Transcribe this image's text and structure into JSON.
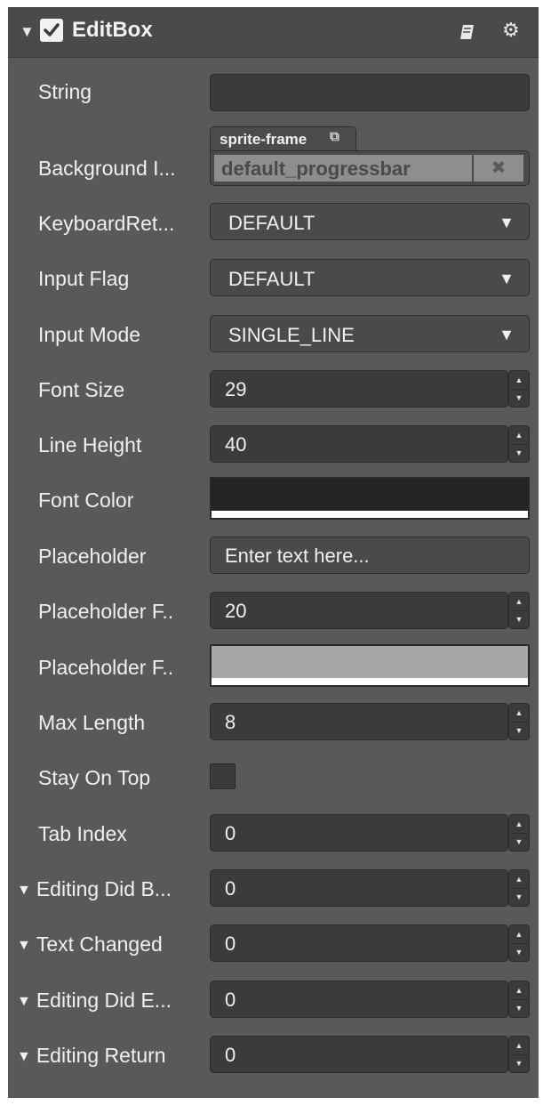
{
  "header": {
    "title": "EditBox",
    "enabled": true,
    "icons": [
      "book-icon",
      "gear-icon"
    ]
  },
  "fields": {
    "string": {
      "label": "String",
      "value": ""
    },
    "background": {
      "label": "Background I...",
      "tag": "sprite-frame",
      "value": "default_progressbar",
      "clear": "✖"
    },
    "keyboard_return": {
      "label": "KeyboardRet...",
      "value": "DEFAULT"
    },
    "input_flag": {
      "label": "Input Flag",
      "value": "DEFAULT"
    },
    "input_mode": {
      "label": "Input Mode",
      "value": "SINGLE_LINE"
    },
    "font_size": {
      "label": "Font Size",
      "value": "29"
    },
    "line_height": {
      "label": "Line Height",
      "value": "40"
    },
    "font_color": {
      "label": "Font Color",
      "color": "#232323"
    },
    "placeholder": {
      "label": "Placeholder",
      "value": "Enter text here..."
    },
    "placeholder_font_size": {
      "label": "Placeholder F..",
      "value": "20"
    },
    "placeholder_font_color": {
      "label": "Placeholder F..",
      "color": "#a6a6a6"
    },
    "max_length": {
      "label": "Max Length",
      "value": "8"
    },
    "stay_on_top": {
      "label": "Stay On Top",
      "checked": false
    },
    "tab_index": {
      "label": "Tab Index",
      "value": "0"
    }
  },
  "events": {
    "editing_did_begin": {
      "label": "Editing Did B...",
      "value": "0"
    },
    "text_changed": {
      "label": "Text Changed",
      "value": "0"
    },
    "editing_did_end": {
      "label": "Editing Did E...",
      "value": "0"
    },
    "editing_return": {
      "label": "Editing Return",
      "value": "0"
    }
  },
  "glyphs": {
    "fold": "▼",
    "caret": "▼",
    "spin_up": "▲",
    "spin_down": "▼",
    "link": "⧉"
  }
}
